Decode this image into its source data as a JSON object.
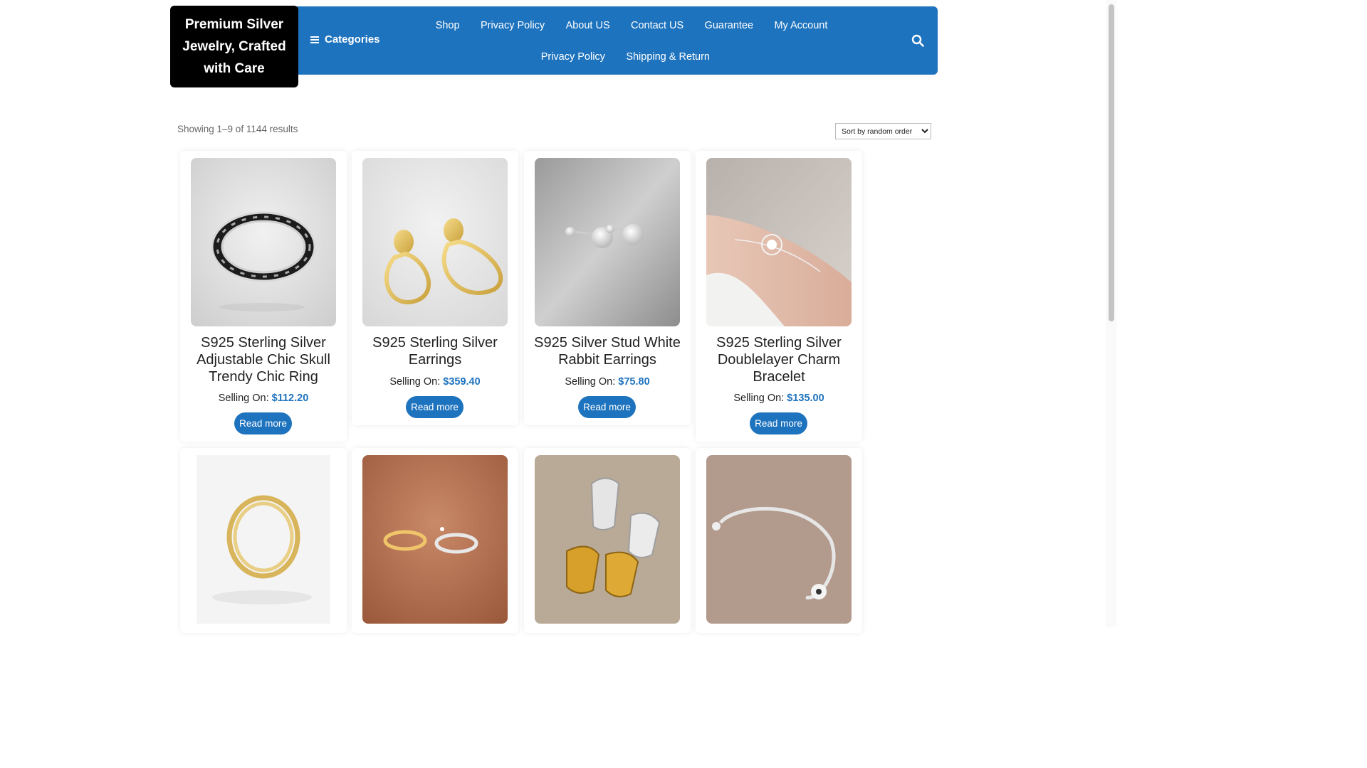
{
  "site": {
    "logo_text": "Premium Silver Jewelry, Crafted with Care"
  },
  "nav": {
    "categories_label": "Categories",
    "row1": [
      "Shop",
      "Privacy Policy",
      "About US",
      "Contact US",
      "Guarantee",
      "My Account"
    ],
    "row2": [
      "Privacy Policy",
      "Shipping & Return"
    ],
    "search_icon": "search-icon"
  },
  "listing": {
    "results_text": "Showing 1–9 of 1144 results",
    "sort_selected": "Sort by random order"
  },
  "products": [
    {
      "title": "S925 Sterling Silver Adjustable Chic Skull Trendy Chic Ring",
      "price_label": "Selling On:",
      "price": "$112.20",
      "button": "Read more"
    },
    {
      "title": "S925 Sterling Silver Earrings",
      "price_label": "Selling On:",
      "price": "$359.40",
      "button": "Read more"
    },
    {
      "title": "S925 Silver Stud White Rabbit Earrings",
      "price_label": "Selling On:",
      "price": "$75.80",
      "button": "Read more"
    },
    {
      "title": "S925 Sterling Silver Doublelayer Charm Bracelet",
      "price_label": "Selling On:",
      "price": "$135.00",
      "button": "Read more"
    }
  ],
  "colors": {
    "brand_blue": "#1e73be",
    "logo_bg": "#000000"
  }
}
